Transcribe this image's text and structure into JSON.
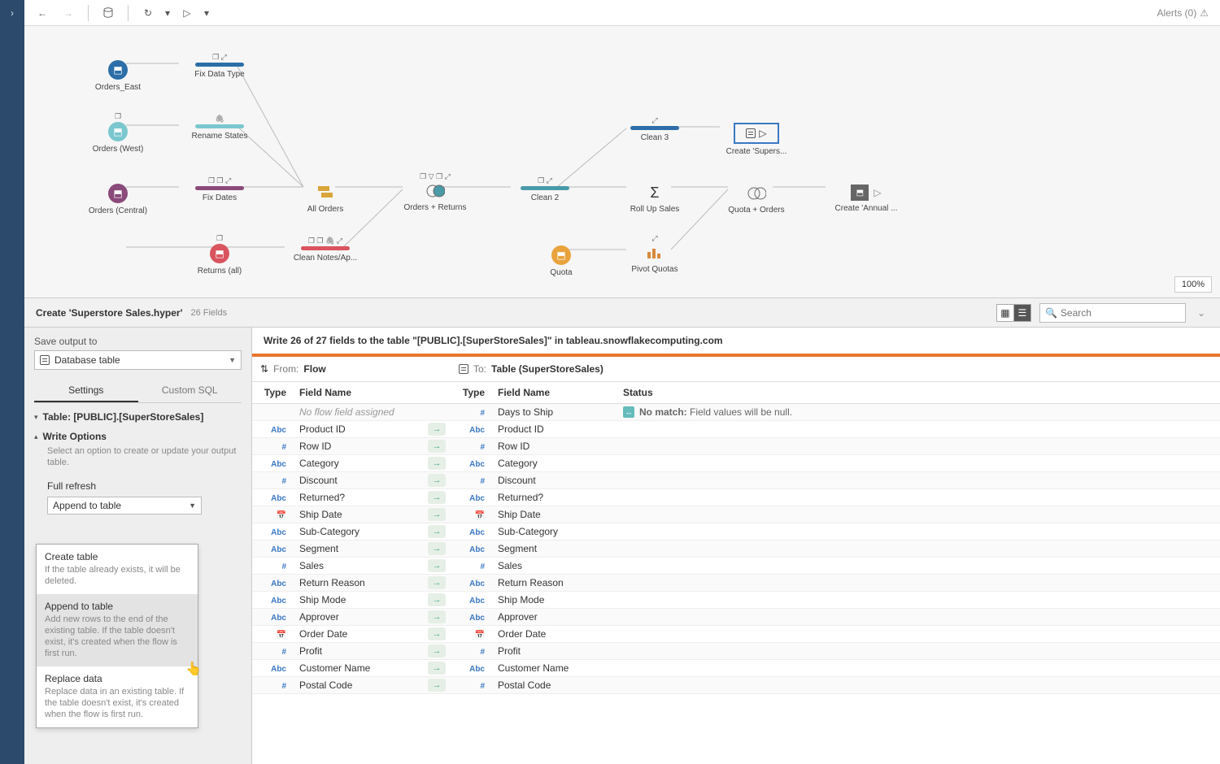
{
  "toolbar": {
    "alerts_label": "Alerts (0)"
  },
  "canvas": {
    "zoom": "100%",
    "nodes": {
      "orders_east": "Orders_East",
      "orders_west": "Orders (West)",
      "orders_central": "Orders (Central)",
      "returns_all": "Returns (all)",
      "fix_data_type": "Fix Data Type",
      "rename_states": "Rename States",
      "fix_dates": "Fix Dates",
      "clean_notes": "Clean Notes/Ap...",
      "all_orders": "All Orders",
      "orders_returns": "Orders + Returns",
      "clean2": "Clean 2",
      "quota": "Quota",
      "clean3": "Clean 3",
      "rollup": "Roll Up Sales",
      "pivot": "Pivot Quotas",
      "create_supers": "Create 'Supers...",
      "quota_orders": "Quota + Orders",
      "create_annual": "Create 'Annual ..."
    }
  },
  "detail": {
    "title": "Create 'Superstore Sales.hyper'",
    "fields_count": "26 Fields",
    "search_placeholder": "Search"
  },
  "left_panel": {
    "save_output_label": "Save output to",
    "target_type": "Database table",
    "tabs": {
      "settings": "Settings",
      "custom_sql": "Custom SQL"
    },
    "table_label": "Table: [PUBLIC].[SuperStoreSales]",
    "write_options": "Write Options",
    "write_options_desc": "Select an option to create or update your output table.",
    "full_refresh": "Full refresh",
    "selected_option": "Append to table",
    "dropdown": [
      {
        "title": "Create table",
        "desc": "If the table already exists, it will be deleted."
      },
      {
        "title": "Append to table",
        "desc": "Add new rows to the end of the existing table. If the table doesn't exist, it's created when the flow is first run."
      },
      {
        "title": "Replace data",
        "desc": "Replace data in an existing table. If the table doesn't exist, it's created when the flow is first run."
      }
    ]
  },
  "right_panel": {
    "write_msg": "Write 26 of 27 fields to the table \"[PUBLIC].[SuperStoreSales]\" in tableau.snowflakecomputing.com",
    "from_label": "From:",
    "from_value": "Flow",
    "to_label": "To:",
    "to_value": "Table (SuperStoreSales)",
    "headers": {
      "type": "Type",
      "field_name": "Field Name",
      "status": "Status"
    },
    "nomatch_prefix": "No match:",
    "nomatch_text": "Field values will be null.",
    "noflow_text": "No flow field assigned",
    "rows": [
      {
        "l_type": "",
        "l_name": "",
        "arrow": false,
        "r_type": "#",
        "r_name": "Days to Ship",
        "nomatch": true
      },
      {
        "l_type": "Abc",
        "l_name": "Product ID",
        "arrow": true,
        "r_type": "Abc",
        "r_name": "Product ID"
      },
      {
        "l_type": "#",
        "l_name": "Row ID",
        "arrow": true,
        "r_type": "#",
        "r_name": "Row ID"
      },
      {
        "l_type": "Abc",
        "l_name": "Category",
        "arrow": true,
        "r_type": "Abc",
        "r_name": "Category"
      },
      {
        "l_type": "#",
        "l_name": "Discount",
        "arrow": true,
        "r_type": "#",
        "r_name": "Discount"
      },
      {
        "l_type": "Abc",
        "l_name": "Returned?",
        "arrow": true,
        "r_type": "Abc",
        "r_name": "Returned?"
      },
      {
        "l_type": "date",
        "l_name": "Ship Date",
        "arrow": true,
        "r_type": "date",
        "r_name": "Ship Date"
      },
      {
        "l_type": "Abc",
        "l_name": "Sub-Category",
        "arrow": true,
        "r_type": "Abc",
        "r_name": "Sub-Category"
      },
      {
        "l_type": "Abc",
        "l_name": "Segment",
        "arrow": true,
        "r_type": "Abc",
        "r_name": "Segment"
      },
      {
        "l_type": "#",
        "l_name": "Sales",
        "arrow": true,
        "r_type": "#",
        "r_name": "Sales"
      },
      {
        "l_type": "Abc",
        "l_name": "Return Reason",
        "arrow": true,
        "r_type": "Abc",
        "r_name": "Return Reason"
      },
      {
        "l_type": "Abc",
        "l_name": "Ship Mode",
        "arrow": true,
        "r_type": "Abc",
        "r_name": "Ship Mode"
      },
      {
        "l_type": "Abc",
        "l_name": "Approver",
        "arrow": true,
        "r_type": "Abc",
        "r_name": "Approver"
      },
      {
        "l_type": "date",
        "l_name": "Order Date",
        "arrow": true,
        "r_type": "date",
        "r_name": "Order Date"
      },
      {
        "l_type": "#",
        "l_name": "Profit",
        "arrow": true,
        "r_type": "#",
        "r_name": "Profit"
      },
      {
        "l_type": "Abc",
        "l_name": "Customer Name",
        "arrow": true,
        "r_type": "Abc",
        "r_name": "Customer Name"
      },
      {
        "l_type": "#",
        "l_name": "Postal Code",
        "arrow": true,
        "r_type": "#",
        "r_name": "Postal Code"
      }
    ]
  }
}
